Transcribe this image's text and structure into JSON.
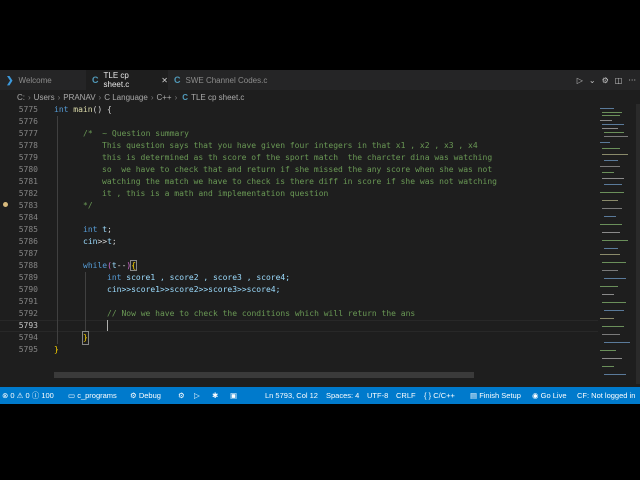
{
  "tabs": [
    {
      "label": "Welcome",
      "icon": "vscode-logo-icon",
      "active": false
    },
    {
      "label": "TLE cp sheet.c",
      "icon": "c-file-icon",
      "active": true
    },
    {
      "label": "SWE Channel Codes.c",
      "icon": "c-file-icon",
      "active": false
    }
  ],
  "breadcrumb": [
    "C:",
    "Users",
    "PRANAV",
    "C Language",
    "C++",
    "TLE cp sheet.c"
  ],
  "editor": {
    "line_numbers": [
      "5775",
      "5776",
      "5777",
      "5778",
      "5779",
      "5780",
      "5781",
      "5782",
      "5783",
      "5784",
      "5785",
      "5786",
      "5787",
      "5788",
      "5789",
      "5790",
      "5791",
      "5792",
      "5793",
      "5794",
      "5795"
    ],
    "current_line": "5793",
    "code": {
      "l5775_kw": "int",
      "l5775_fn": "main",
      "l5775_rest": "() {",
      "l5777": "/*  ~ Question summary",
      "l5778": "This question says that you have given four integers in that x1 , x2 , x3 , x4",
      "l5779": "this is determined as th score of the sport match  the charcter dina was watching",
      "l5780": "so  we have to check that and return if she missed the any score when she was not",
      "l5781": "watching the match we have to check is there diff in score if she was not watching",
      "l5782": "it , this is a math and implementation question",
      "l5783": "*/",
      "l5785_kw": "int",
      "l5785_var": "t",
      "l5785_end": ";",
      "l5786_var1": "cin",
      "l5786_op": ">>",
      "l5786_var2": "t",
      "l5786_end": ";",
      "l5788_kw": "while",
      "l5788_open": "(",
      "l5788_var": "t",
      "l5788_op": "--",
      "l5788_close": ")",
      "l5788_brace": "{",
      "l5789_kw": "int",
      "l5789_rest": "score1 , score2 , score3 , score4;",
      "l5790": "cin>>score1>>score2>>score3>>score4;",
      "l5792": "// Now we have to check the conditions which will return the ans",
      "l5794": "}",
      "l5795": "}"
    }
  },
  "status": {
    "errors": "0",
    "warnings": "0",
    "info": "100",
    "folder": "c_programs",
    "debug": "Debug",
    "position": "Ln 5793, Col 12",
    "spaces": "Spaces: 4",
    "encoding": "UTF-8",
    "eol": "CRLF",
    "language": "C/C++",
    "finish_setup": "Finish Setup",
    "go_live": "Go Live",
    "account": "CF: Not logged in"
  },
  "colors": {
    "statusbar": "#007acc",
    "editor_bg": "#1e1e1e",
    "keyword": "#569cd6",
    "comment": "#6a9955"
  }
}
